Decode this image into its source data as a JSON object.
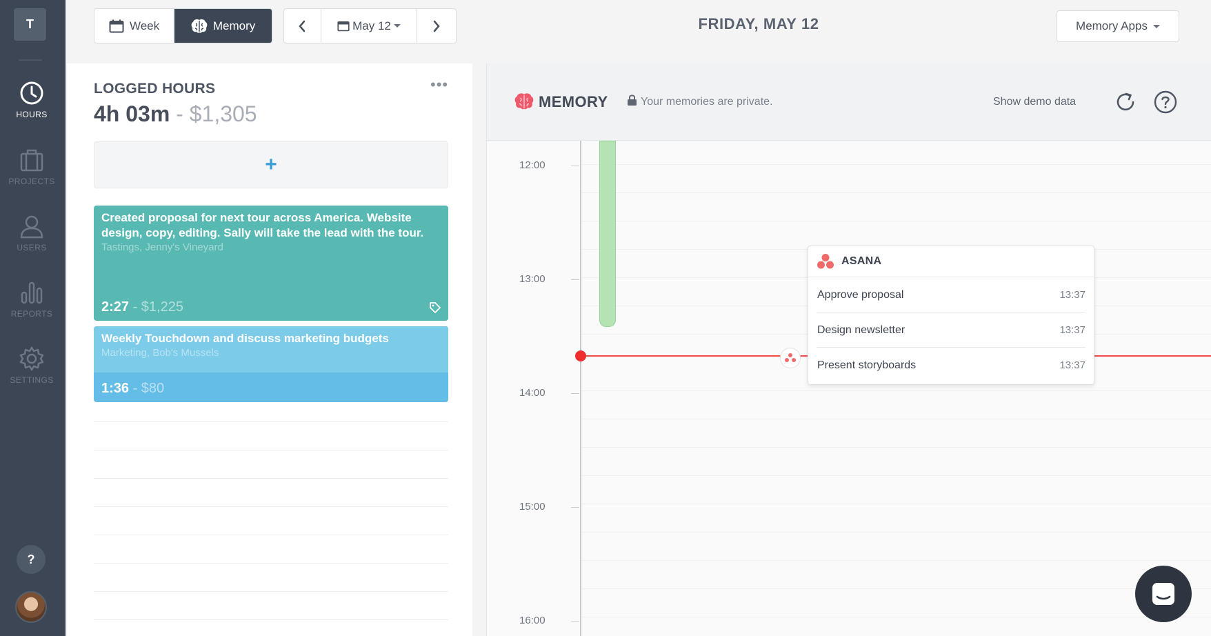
{
  "sidebar": {
    "workspace_initial": "T",
    "items": [
      {
        "label": "HOURS",
        "icon": "clock-icon",
        "active": true
      },
      {
        "label": "PROJECTS",
        "icon": "briefcase-icon",
        "active": false
      },
      {
        "label": "USERS",
        "icon": "user-icon",
        "active": false
      },
      {
        "label": "REPORTS",
        "icon": "bar-chart-icon",
        "active": false
      },
      {
        "label": "SETTINGS",
        "icon": "gear-icon",
        "active": false
      }
    ],
    "help_label": "?"
  },
  "toolbar": {
    "view_tabs": [
      {
        "label": "Week",
        "icon": "calendar-icon",
        "active": false
      },
      {
        "label": "Memory",
        "icon": "brain-icon",
        "active": true
      }
    ],
    "date_label": "May 12",
    "day_title": "FRIDAY, MAY 12",
    "apps_label": "Memory Apps"
  },
  "logged": {
    "title": "LOGGED HOURS",
    "duration": "4h 03m",
    "separator": " - ",
    "amount": "$1,305",
    "more": "•••",
    "add_label": "+",
    "entries": [
      {
        "description": "Created proposal for next tour across America. Website design, copy, editing. Sally will take the lead with the tour.",
        "meta": "Tastings, Jenny's Vineyard",
        "duration": "2:27",
        "amount": " - $1,225",
        "color": "#58b9b3"
      },
      {
        "description": "Weekly Touchdown and discuss marketing budgets",
        "meta": "Marketing, Bob's Mussels",
        "duration": "1:36",
        "amount": " - $80",
        "color": "#64bde6"
      }
    ]
  },
  "memory": {
    "title": "MEMORY",
    "privacy_note": "Your memories are private.",
    "demo_link": "Show demo data",
    "times": [
      "12:00",
      "13:00",
      "14:00",
      "15:00",
      "16:00"
    ],
    "accent_color": "#ef4b4b",
    "popup": {
      "app": "ASANA",
      "items": [
        {
          "label": "Approve proposal",
          "time": "13:37"
        },
        {
          "label": "Design newsletter",
          "time": "13:37"
        },
        {
          "label": "Present storyboards",
          "time": "13:37"
        }
      ]
    }
  }
}
